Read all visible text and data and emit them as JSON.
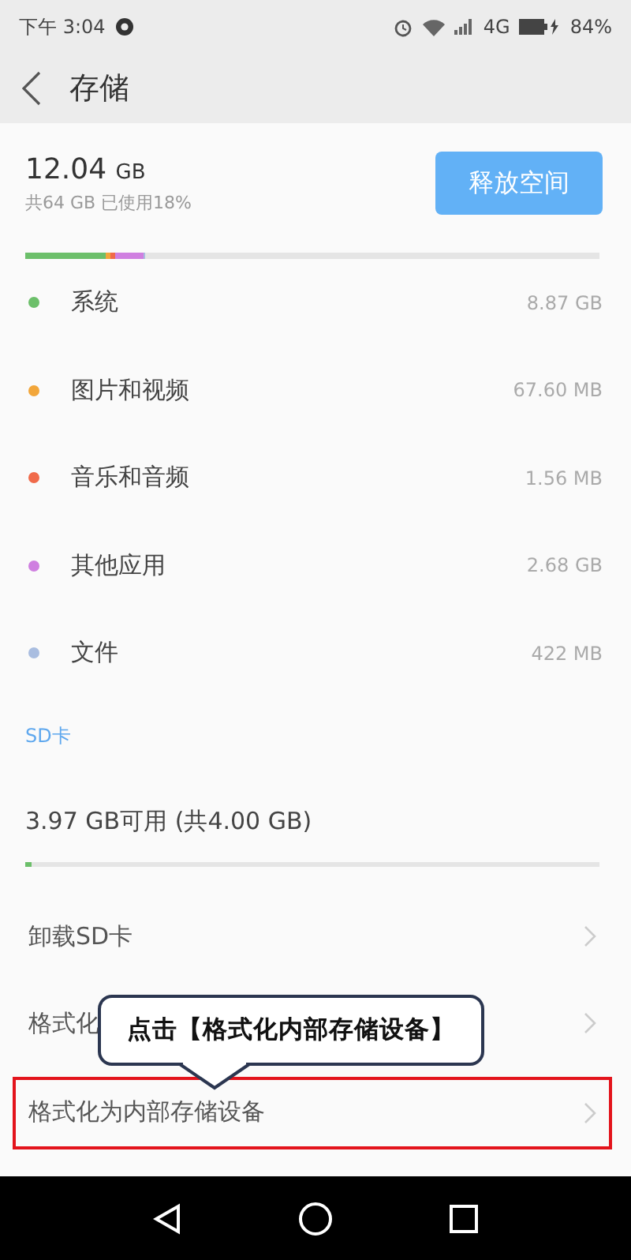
{
  "status_bar": {
    "time": "下午 3:04",
    "network": "4G",
    "battery": "84%"
  },
  "header": {
    "title": "存储"
  },
  "storage": {
    "used": "12.04",
    "unit": "GB",
    "summary": "共64 GB 已使用18%",
    "button": "释放空间"
  },
  "categories": [
    {
      "name": "系统",
      "size": "8.87 GB",
      "color": "#6cbf6a"
    },
    {
      "name": "图片和视频",
      "size": "67.60 MB",
      "color": "#f2a63a"
    },
    {
      "name": "音乐和音频",
      "size": "1.56 MB",
      "color": "#f06a4a"
    },
    {
      "name": "其他应用",
      "size": "2.68 GB",
      "color": "#cf7fe0"
    },
    {
      "name": "文件",
      "size": "422 MB",
      "color": "#a9bde0"
    }
  ],
  "sd_card": {
    "heading": "SD卡",
    "summary": "3.97 GB可用 (共4.00 GB)",
    "level": 0.01
  },
  "actions": [
    {
      "label": "卸载SD卡",
      "highlighted": false
    },
    {
      "label": "格式化",
      "highlighted": false
    },
    {
      "label": "格式化为内部存储设备",
      "highlighted": true
    }
  ],
  "callout": {
    "text": "点击【格式化内部存储设备】"
  }
}
